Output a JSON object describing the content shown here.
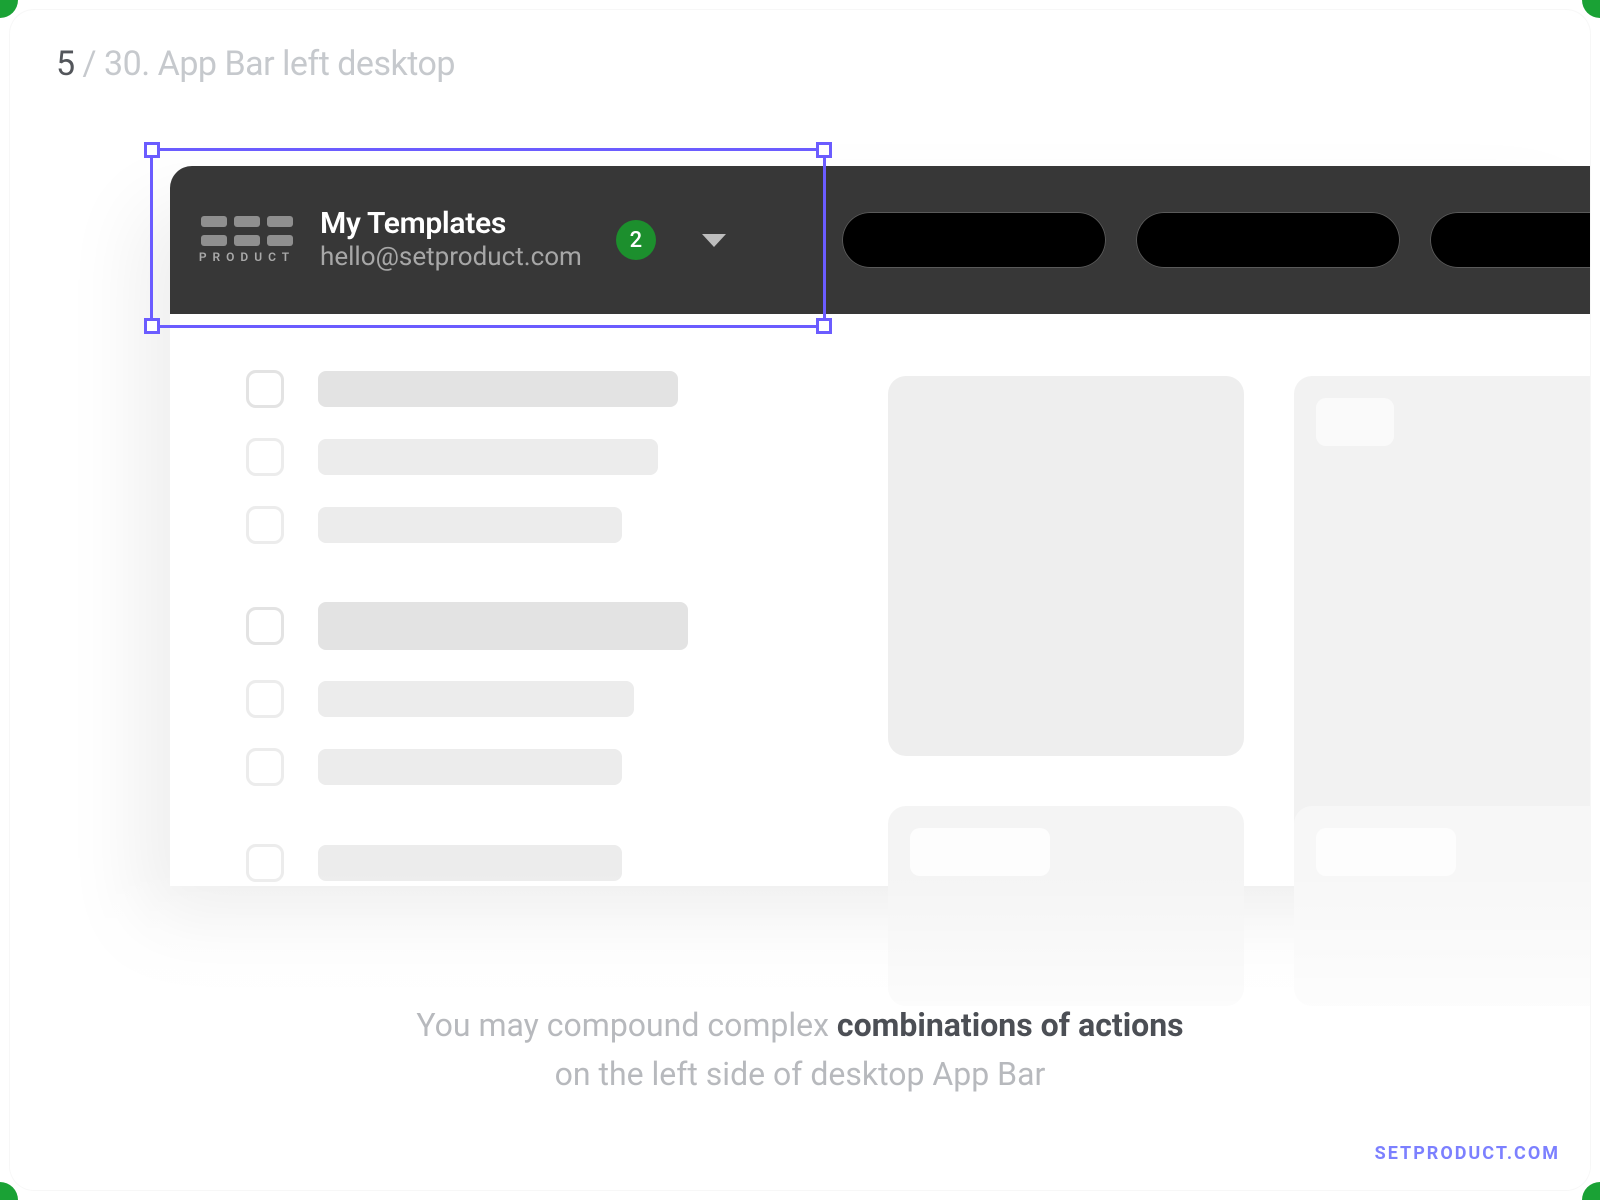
{
  "pager": {
    "current": "5",
    "sep": " / ",
    "total": "30.",
    "name": "App Bar left desktop"
  },
  "appbar": {
    "logo_sub": "PRODUCT",
    "title": "My Templates",
    "subtitle": "hello@setproduct.com",
    "badge": "2"
  },
  "caption": {
    "line1_a": "You may compound complex ",
    "line1_b": "combinations of actions",
    "line2": "on the left side of desktop App Bar"
  },
  "watermark": "SETPRODUCT.COM"
}
